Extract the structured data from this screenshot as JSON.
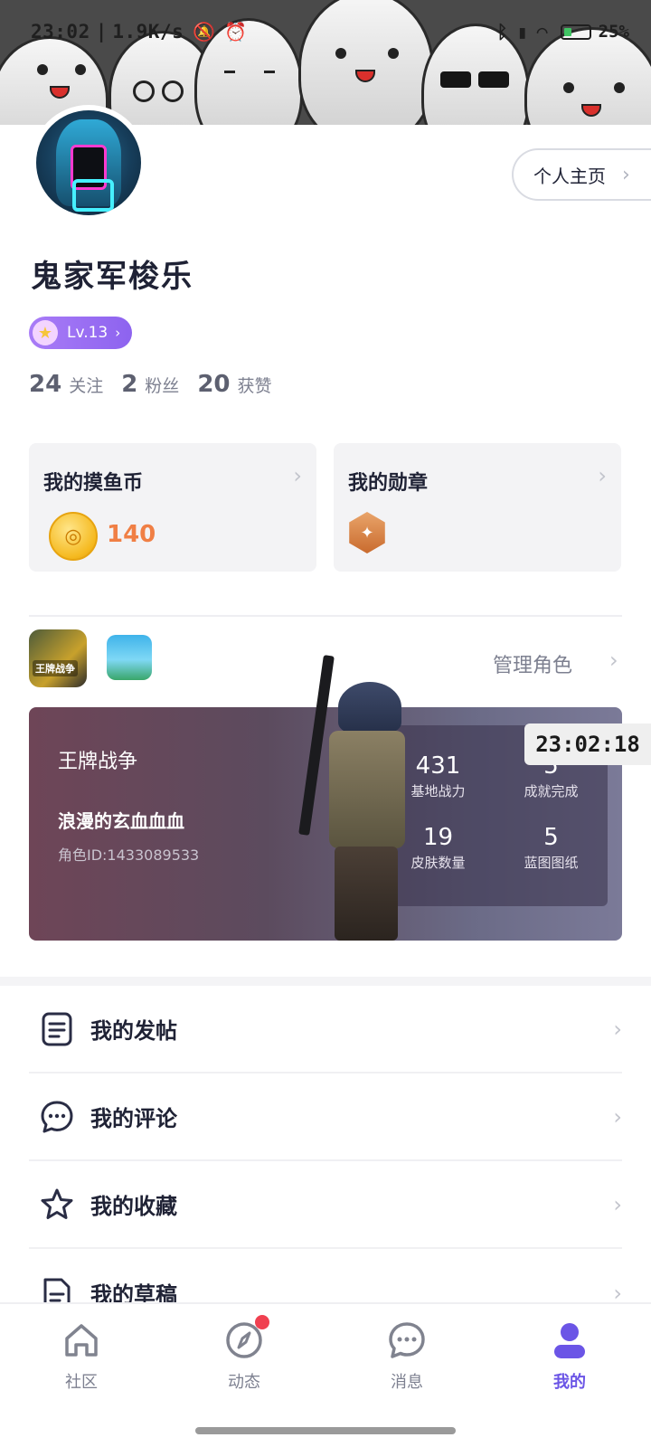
{
  "status_bar": {
    "time": "23:02",
    "network_speed": "1.9K/s",
    "battery": "25%"
  },
  "profile": {
    "homepage_button": "个人主页",
    "nickname": "鬼家军梭乐",
    "level": "Lv.13",
    "stats": [
      {
        "value": "24",
        "label": "关注"
      },
      {
        "value": "2",
        "label": "粉丝"
      },
      {
        "value": "20",
        "label": "获赞"
      }
    ]
  },
  "cards": {
    "coins": {
      "title": "我的摸鱼币",
      "value": "140"
    },
    "medals": {
      "title": "我的勋章"
    }
  },
  "games": {
    "icon_a_text": "王牌战争",
    "manage_label": "管理角色"
  },
  "role_card": {
    "game_name": "王牌战争",
    "role_name": "浪漫的玄血血血",
    "role_id": "角色ID:1433089533",
    "stats": [
      {
        "value": "431",
        "label": "基地战力"
      },
      {
        "value": "5",
        "label": "成就完成"
      },
      {
        "value": "19",
        "label": "皮肤数量"
      },
      {
        "value": "5",
        "label": "蓝图图纸"
      }
    ]
  },
  "overlay_clock": "23:02:18",
  "menu": [
    {
      "label": "我的发帖",
      "icon": "post-icon"
    },
    {
      "label": "我的评论",
      "icon": "comment-icon"
    },
    {
      "label": "我的收藏",
      "icon": "star-icon"
    },
    {
      "label": "我的草稿",
      "icon": "draft-icon"
    }
  ],
  "tabs": [
    {
      "label": "社区",
      "icon": "home-icon"
    },
    {
      "label": "动态",
      "icon": "compass-icon",
      "badge": true
    },
    {
      "label": "消息",
      "icon": "message-icon"
    },
    {
      "label": "我的",
      "icon": "user-icon",
      "active": true
    }
  ],
  "colors": {
    "accent": "#6b55e6",
    "coin": "#f07f45",
    "badge": "#f04050"
  }
}
